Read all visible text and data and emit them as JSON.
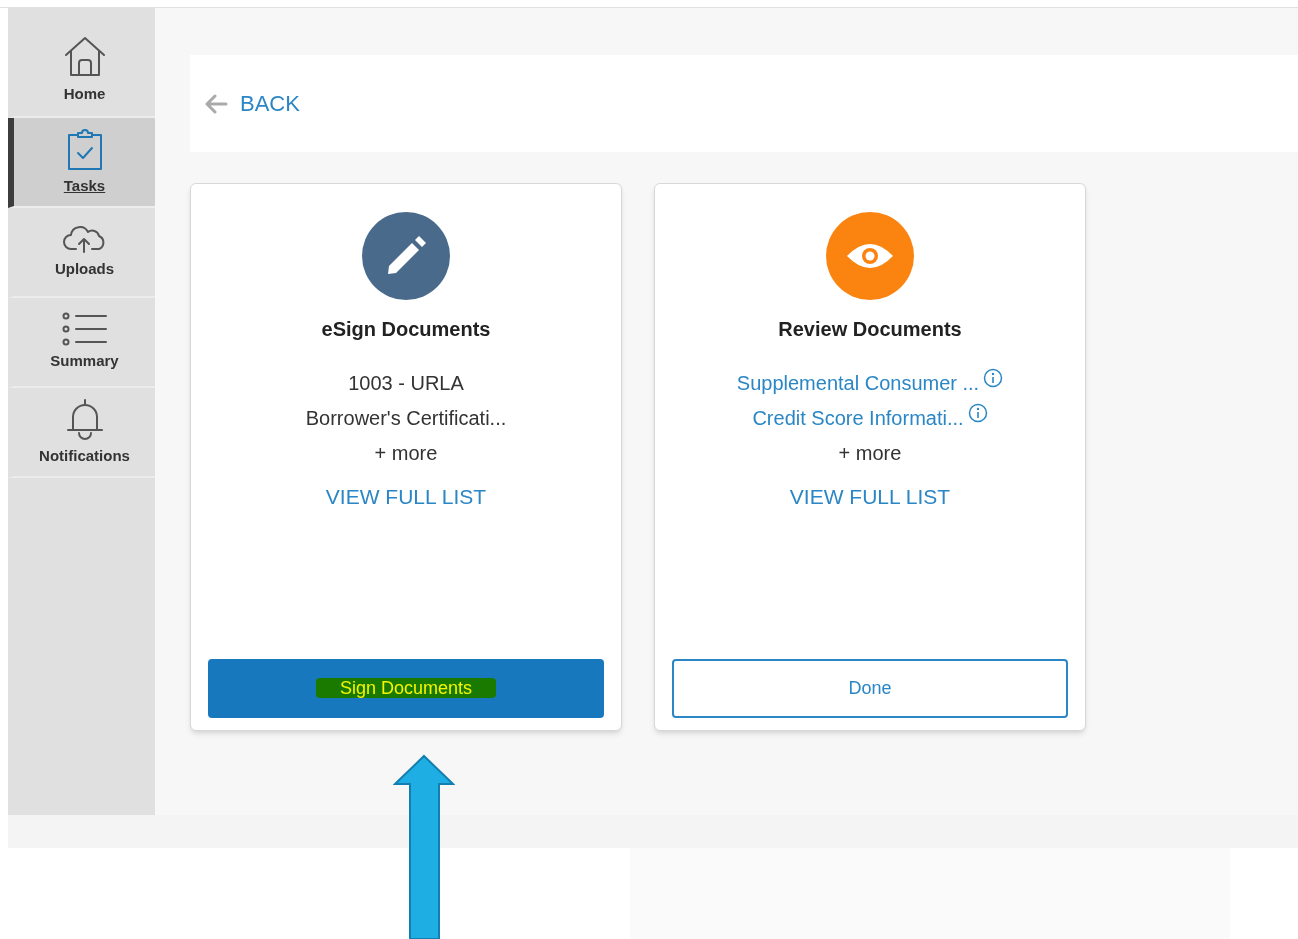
{
  "sidebar": {
    "items": [
      {
        "label": "Home",
        "kind": "home",
        "selected": false
      },
      {
        "label": "Tasks",
        "kind": "tasks",
        "selected": true
      },
      {
        "label": "Uploads",
        "kind": "upload",
        "selected": false
      },
      {
        "label": "Summary",
        "kind": "list",
        "selected": false
      },
      {
        "label": "Notifications",
        "kind": "bell",
        "selected": false
      }
    ]
  },
  "back_link": {
    "label": "BACK"
  },
  "cards": [
    {
      "kind": "esign",
      "title": "eSign Documents",
      "documents": [
        {
          "name": "1003 - URLA",
          "kind": "plain"
        },
        {
          "name": "Borrower's Certificati...",
          "kind": "plain"
        }
      ],
      "more": "+ more",
      "view_list": "VIEW FULL LIST",
      "action": {
        "label": "Sign Documents",
        "kind": "primary",
        "highlighted": true
      }
    },
    {
      "kind": "review",
      "title": "Review Documents",
      "documents": [
        {
          "name": "Supplemental Consumer ...",
          "kind": "info-link"
        },
        {
          "name": "Credit Score Informati...",
          "kind": "info-link"
        }
      ],
      "more": "+ more",
      "view_list": "VIEW FULL LIST",
      "action": {
        "label": "Done",
        "kind": "outline",
        "highlighted": false
      }
    }
  ]
}
